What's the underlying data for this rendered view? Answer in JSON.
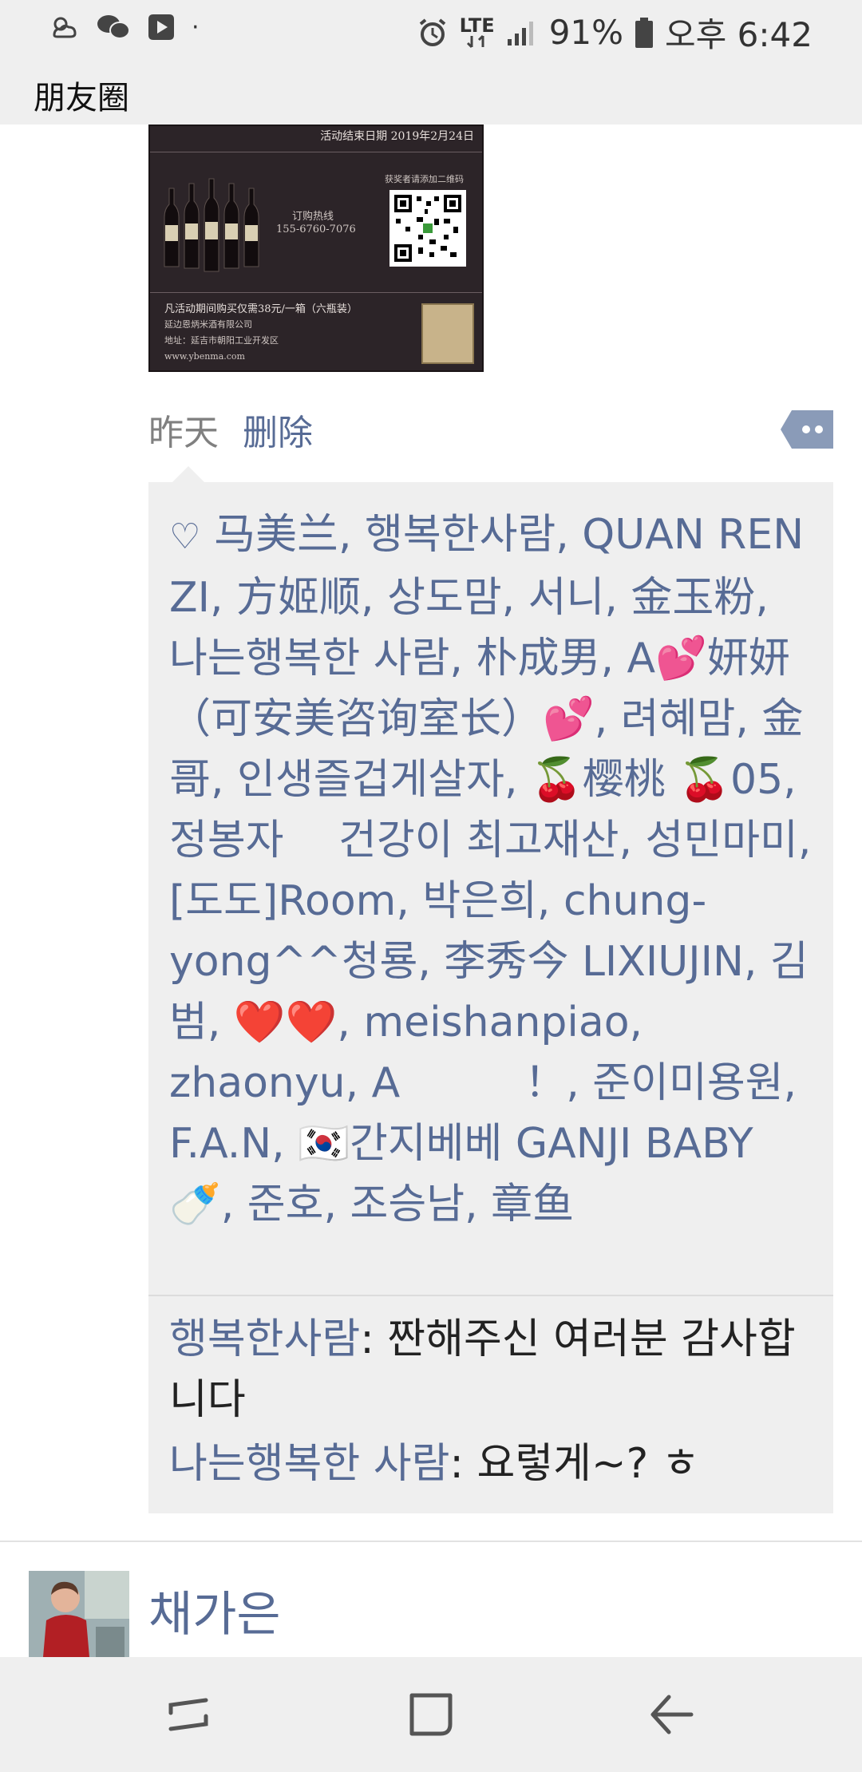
{
  "status_bar": {
    "network": "LTE",
    "battery": "91%",
    "time": "오후 6:42"
  },
  "header": {
    "title": "朋友圈"
  },
  "ad": {
    "date_line": "活动结束日期 2019年2月24日",
    "hotline_label": "订购热线",
    "hotline": "155-6760-7076",
    "qr_label": "获奖者请添加二维码",
    "price_line": "凡活动期间购买仅需38元/一箱（六瓶装）",
    "company": "延边恩炳米酒有限公司",
    "address": "地址：延吉市朝阳工业开发区",
    "url": "www.ybenma.com"
  },
  "post": {
    "time": "昨天",
    "delete_label": "删除"
  },
  "likes": {
    "heart_icon": "♡",
    "text": "马美兰, 행복한사람, QUAN REN ZI, 方姬顺, 상도맘, 서니, 金玉粉, 나는행복한 사람, 朴成男, A💕妍妍（可安美咨询室长）💕, 려혜맘, 金哥, 인생즐겁게살자, 🍒樱桃 🍒05, 정봉자　 건강이 최고재산, 성민마미, [도도]Room, 박은희, chung-yong^^청룡, 李秀今  LIXIUJIN, 김범, ❤️❤️, meishanpiao, zhaonyu, A　　　！, 준이미용원, F.A.N, 🇰🇷간지베베 GANJI BABY 🍼, 준호, 조승남, 章鱼"
  },
  "comments": [
    {
      "author": "행복한사람",
      "separator": ": ",
      "text": "짠해주신 여러분 감사합니다"
    },
    {
      "author": "나는행복한 사람",
      "separator": ": ",
      "text": "요렇게~? ㅎ"
    }
  ],
  "next_post": {
    "name": "채가은"
  },
  "colors": {
    "link_blue": "#576b95",
    "panel_bg": "#efefef",
    "bar_bg": "#efefef"
  }
}
